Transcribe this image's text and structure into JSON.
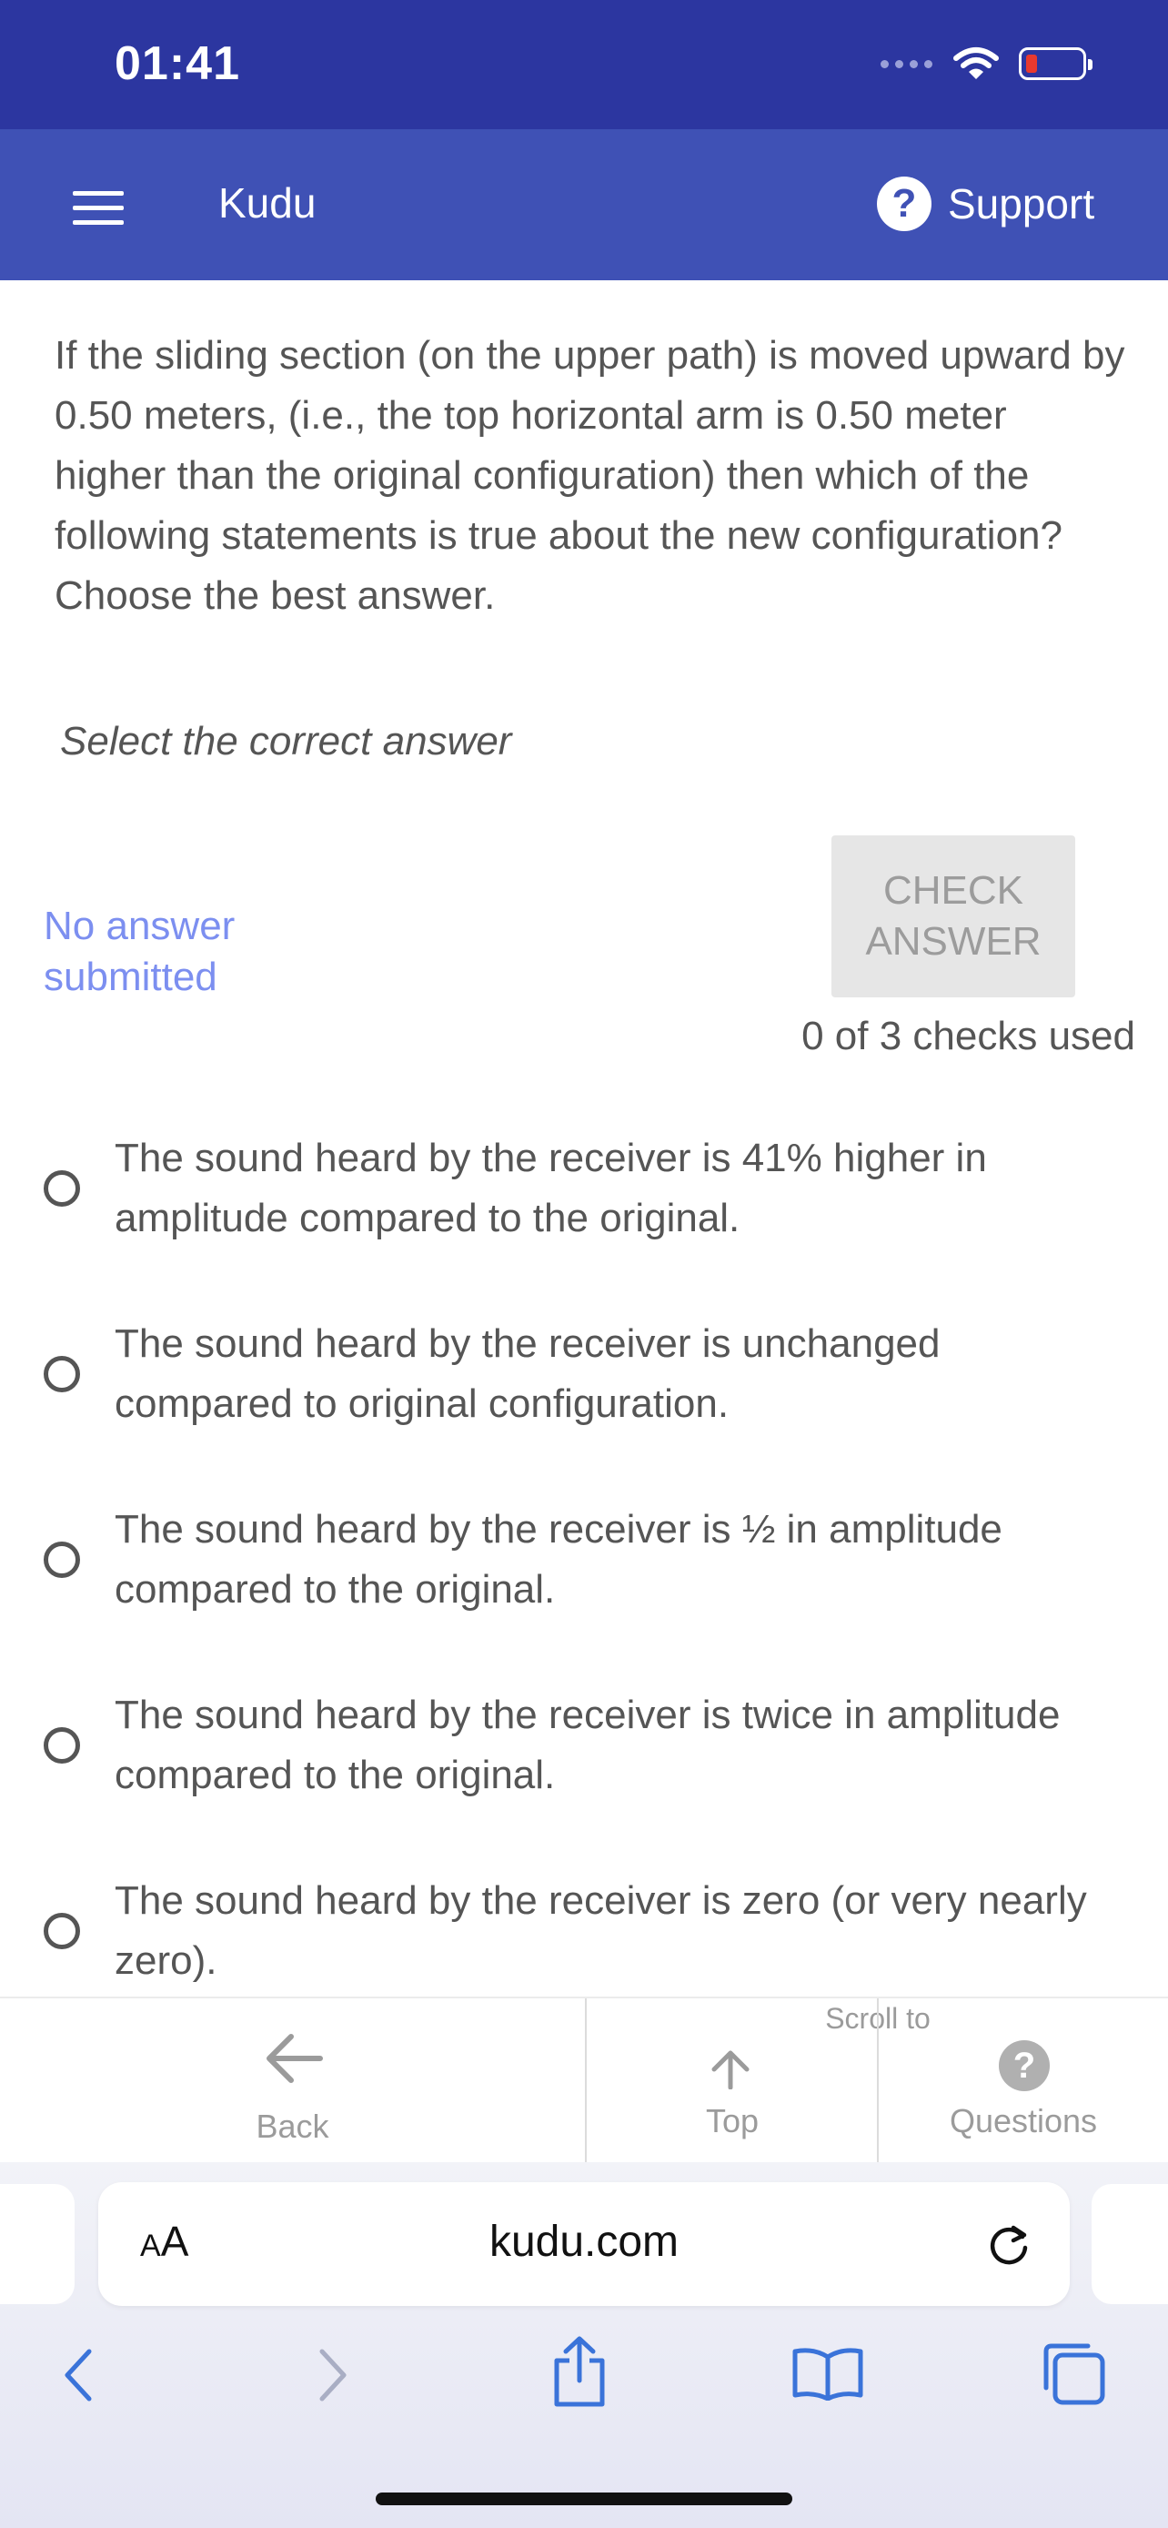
{
  "status_bar": {
    "time": "01:41"
  },
  "header": {
    "app_title": "Kudu",
    "support_label": "Support",
    "help_glyph": "?"
  },
  "question": {
    "text": "If the sliding section (on the upper path) is moved upward by 0.50 meters, (i.e., the top horizontal arm is 0.50 meter higher than the original configuration) then which of the following statements is true about the new configuration? Choose the best answer.",
    "instruction": "Select the correct answer",
    "submission_status": "No answer submitted",
    "check_button_label": "CHECK ANSWER",
    "checks_used": "0 of 3 checks used"
  },
  "options": [
    " The sound heard by the receiver is 41% higher in amplitude compared to the original.",
    "The sound heard by the receiver is unchanged compared to original configuration.",
    "The sound heard by the receiver is ½ in amplitude compared to the original.",
    "The sound heard by the receiver is twice in amplitude compared to the original.",
    "The sound heard by the receiver is zero (or very nearly zero)."
  ],
  "bottom_nav": {
    "back_label": "Back",
    "scroll_to_label": "Scroll to",
    "top_label": "Top",
    "questions_label": "Questions",
    "questions_glyph": "?"
  },
  "browser": {
    "aa_label_small": "A",
    "aa_label_large": "A",
    "url": "kudu.com"
  },
  "colors": {
    "status_bar": "#2c36a0",
    "header": "#3f51b5",
    "link": "#7c8ff0",
    "safari_icons": "#3a73d9"
  },
  "icons": [
    "hamburger-icon",
    "help-icon",
    "back-arrow-icon",
    "up-arrow-icon",
    "reload-icon",
    "chevron-left-icon",
    "chevron-right-icon",
    "share-icon",
    "bookmarks-icon",
    "tabs-icon"
  ]
}
